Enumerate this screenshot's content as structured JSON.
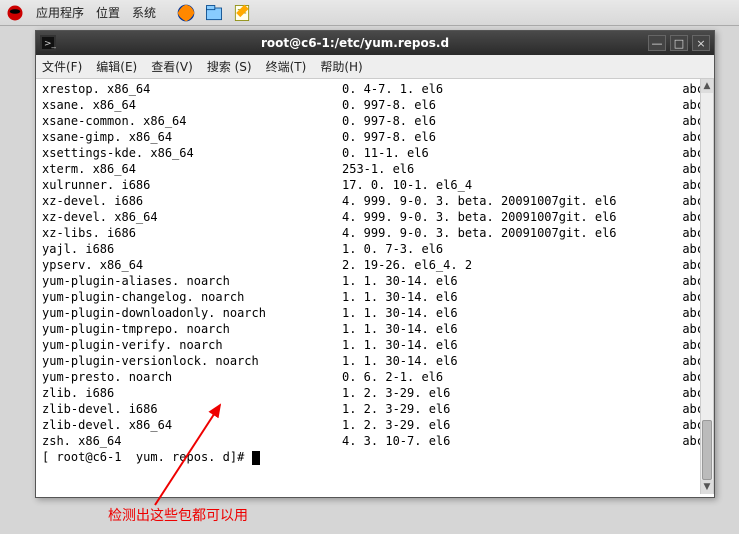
{
  "panel": {
    "menu_apps": "应用程序",
    "menu_places": "位置",
    "menu_system": "系统"
  },
  "window": {
    "title": "root@c6-1:/etc/yum.repos.d"
  },
  "menubar": {
    "file": "文件(F)",
    "edit": "编辑(E)",
    "view": "查看(V)",
    "search": "搜索 (S)",
    "terminal": "终端(T)",
    "help": "帮助(H)"
  },
  "packages": [
    {
      "name": "xrestop. x86_64",
      "version": "0. 4-7. 1. el6",
      "repo": "abc"
    },
    {
      "name": "xsane. x86_64",
      "version": "0. 997-8. el6",
      "repo": "abc"
    },
    {
      "name": "xsane-common. x86_64",
      "version": "0. 997-8. el6",
      "repo": "abc"
    },
    {
      "name": "xsane-gimp. x86_64",
      "version": "0. 997-8. el6",
      "repo": "abc"
    },
    {
      "name": "xsettings-kde. x86_64",
      "version": "0. 11-1. el6",
      "repo": "abc"
    },
    {
      "name": "xterm. x86_64",
      "version": "253-1. el6",
      "repo": "abc"
    },
    {
      "name": "xulrunner. i686",
      "version": "17. 0. 10-1. el6_4",
      "repo": "abc"
    },
    {
      "name": "xz-devel. i686",
      "version": "4. 999. 9-0. 3. beta. 20091007git. el6",
      "repo": "abc"
    },
    {
      "name": "xz-devel. x86_64",
      "version": "4. 999. 9-0. 3. beta. 20091007git. el6",
      "repo": "abc"
    },
    {
      "name": "xz-libs. i686",
      "version": "4. 999. 9-0. 3. beta. 20091007git. el6",
      "repo": "abc"
    },
    {
      "name": "yajl. i686",
      "version": "1. 0. 7-3. el6",
      "repo": "abc"
    },
    {
      "name": "ypserv. x86_64",
      "version": "2. 19-26. el6_4. 2",
      "repo": "abc"
    },
    {
      "name": "yum-plugin-aliases. noarch",
      "version": "1. 1. 30-14. el6",
      "repo": "abc"
    },
    {
      "name": "yum-plugin-changelog. noarch",
      "version": "1. 1. 30-14. el6",
      "repo": "abc"
    },
    {
      "name": "yum-plugin-downloadonly. noarch",
      "version": "1. 1. 30-14. el6",
      "repo": "abc"
    },
    {
      "name": "yum-plugin-tmprepo. noarch",
      "version": "1. 1. 30-14. el6",
      "repo": "abc"
    },
    {
      "name": "yum-plugin-verify. noarch",
      "version": "1. 1. 30-14. el6",
      "repo": "abc"
    },
    {
      "name": "yum-plugin-versionlock. noarch",
      "version": "1. 1. 30-14. el6",
      "repo": "abc"
    },
    {
      "name": "yum-presto. noarch",
      "version": "0. 6. 2-1. el6",
      "repo": "abc"
    },
    {
      "name": "zlib. i686",
      "version": "1. 2. 3-29. el6",
      "repo": "abc"
    },
    {
      "name": "zlib-devel. i686",
      "version": "1. 2. 3-29. el6",
      "repo": "abc"
    },
    {
      "name": "zlib-devel. x86_64",
      "version": "1. 2. 3-29. el6",
      "repo": "abc"
    },
    {
      "name": "zsh. x86_64",
      "version": "4. 3. 10-7. el6",
      "repo": "abc"
    }
  ],
  "prompt": "[ root@c6-1  yum. repos. d]# ",
  "annotation": "检测出这些包都可以用"
}
